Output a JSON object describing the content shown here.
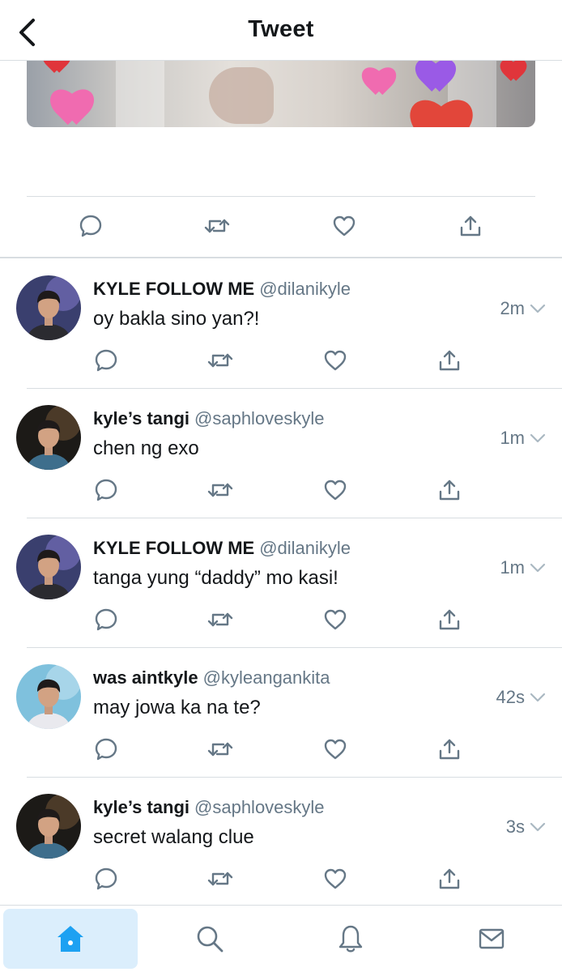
{
  "header": {
    "title": "Tweet"
  },
  "colors": {
    "accent": "#1da1f2",
    "text": "#14171a",
    "muted": "#657786",
    "icon": "#657786"
  },
  "main_tweet_actions": [
    "reply-icon",
    "retweet-icon",
    "like-icon",
    "share-icon"
  ],
  "replies": [
    {
      "name": "KYLE FOLLOW ME",
      "handle": "@dilanikyle",
      "time": "2m",
      "text": "oy bakla sino yan?!"
    },
    {
      "name": "kyle’s tangi",
      "handle": "@saphloveskyle",
      "time": "1m",
      "text": "chen ng exo"
    },
    {
      "name": "KYLE FOLLOW ME",
      "handle": "@dilanikyle",
      "time": "1m",
      "text": "tanga yung “daddy” mo kasi!"
    },
    {
      "name": "was aintkyle",
      "handle": "@kyleangankita",
      "time": "42s",
      "text": "may jowa ka na te?"
    },
    {
      "name": "kyle’s tangi",
      "handle": "@saphloveskyle",
      "time": "3s",
      "text": "secret walang clue"
    }
  ],
  "tabbar": {
    "items": [
      "home-icon",
      "search-icon",
      "notifications-icon",
      "messages-icon"
    ],
    "active": 0
  }
}
